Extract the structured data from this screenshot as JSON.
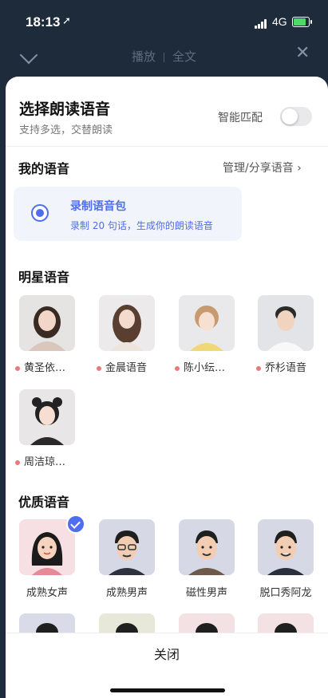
{
  "status_bar": {
    "time": "18:13",
    "network": "4G"
  },
  "top_bar": {
    "tab_play": "播放",
    "tab_fulltext": "全文"
  },
  "sheet": {
    "title": "选择朗读语音",
    "subtitle": "支持多选，交替朗读",
    "smart_match_label": "智能匹配",
    "smart_match_on": false
  },
  "my_voice": {
    "title": "我的语音",
    "manage_link": "管理/分享语音",
    "record_title": "录制语音包",
    "record_desc": "录制 20 句话，生成你的朗读语音"
  },
  "star_voices": {
    "title": "明星语音",
    "items": [
      {
        "name": "黄圣依…"
      },
      {
        "name": "金晨语音"
      },
      {
        "name": "陈小纭…"
      },
      {
        "name": "乔杉语音"
      },
      {
        "name": "周洁琼…"
      }
    ]
  },
  "quality_voices": {
    "title": "优质语音",
    "items": [
      {
        "name": "成熟女声",
        "selected": true
      },
      {
        "name": "成熟男声",
        "selected": false
      },
      {
        "name": "磁性男声",
        "selected": false
      },
      {
        "name": "脱口秀阿龙",
        "selected": false
      }
    ]
  },
  "footer": {
    "close_label": "关闭"
  },
  "colors": {
    "accent": "#4f6df0",
    "dim_bg": "#1d2b3a",
    "star_dot": "#e87a7a"
  }
}
